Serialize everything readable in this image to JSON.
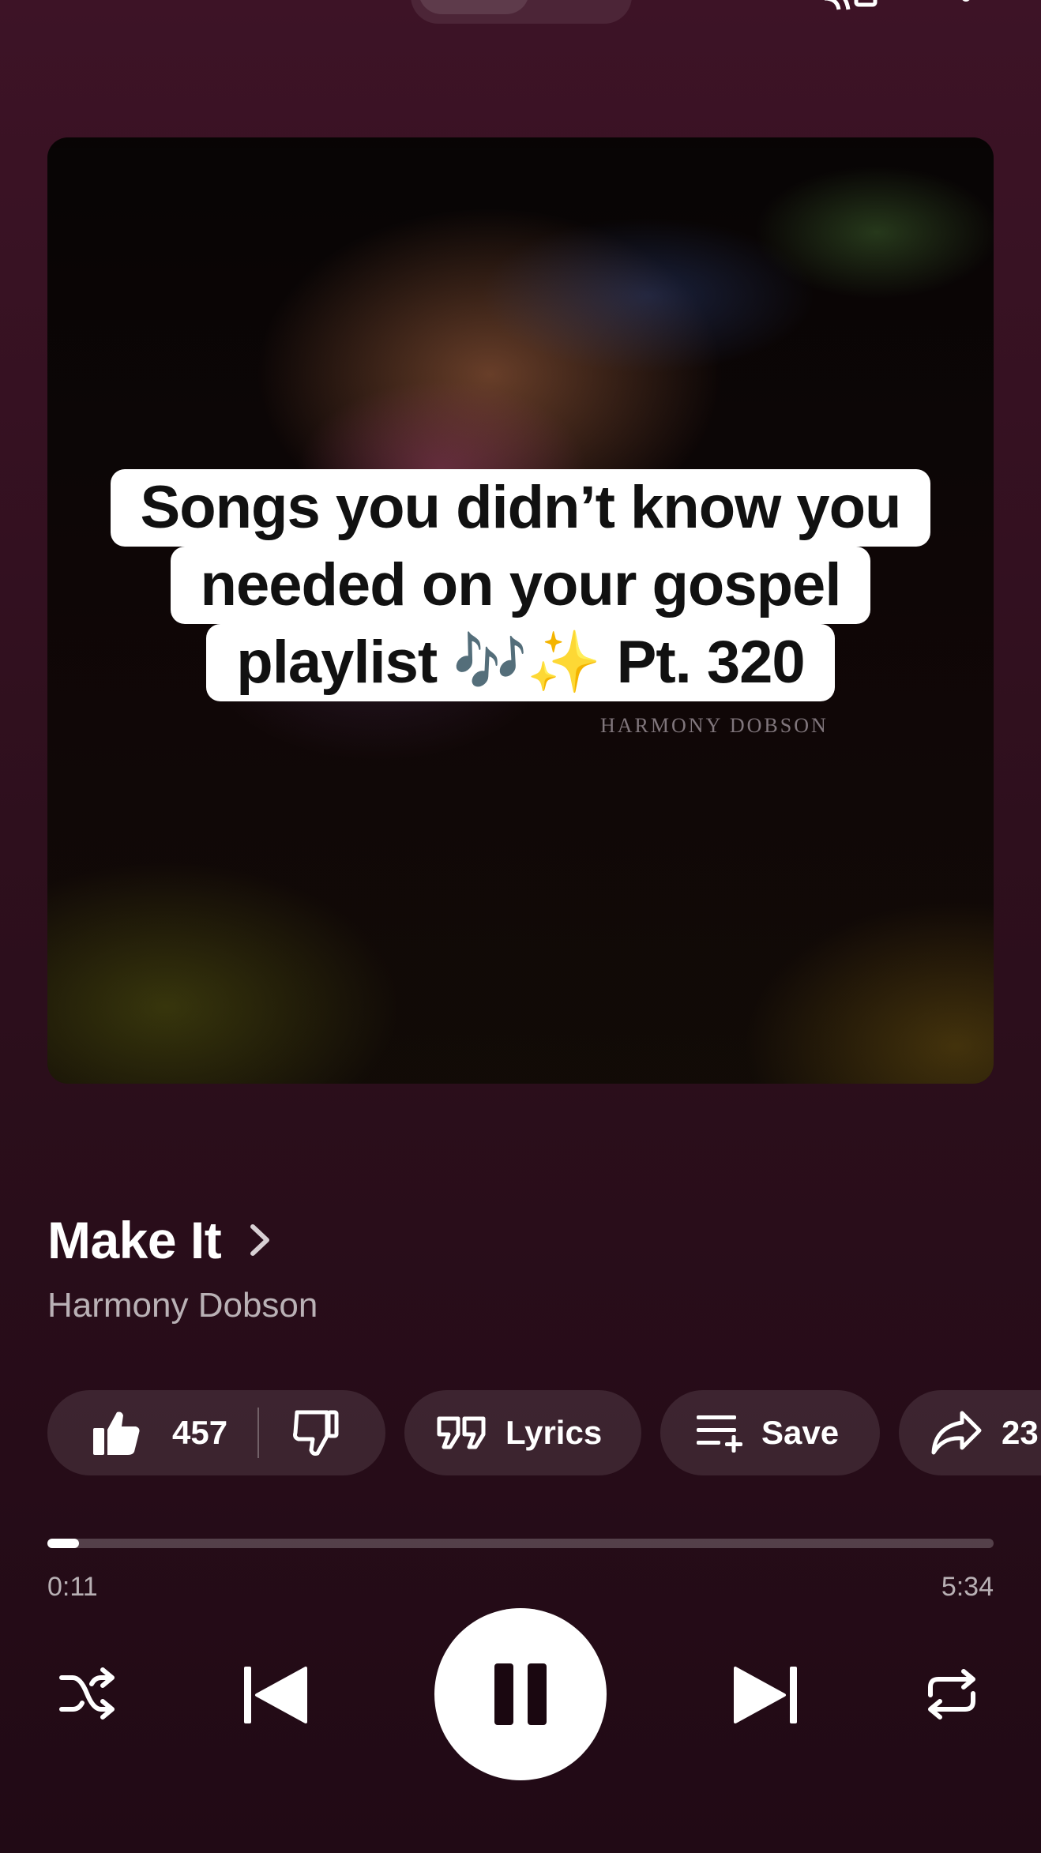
{
  "player": {
    "caption": {
      "line1": "Songs you didn’t know you",
      "line2": "needed on your gospel",
      "line3": "playlist 🎶✨ Pt. 320"
    },
    "art_watermark": "HARMONY DOBSON",
    "track": {
      "title": "Make It",
      "artist": "Harmony Dobson"
    },
    "actions": {
      "like_count": "457",
      "lyrics_label": "Lyrics",
      "save_label": "Save",
      "share_count": "23"
    },
    "progress": {
      "elapsed": "0:11",
      "total": "5:34",
      "fraction": 0.033
    }
  },
  "icons": {
    "top_bar": [
      "cast-icon",
      "more-vert-icon"
    ],
    "actions": [
      "thumbs-up-icon",
      "thumbs-down-icon",
      "quote-icon",
      "playlist-add-icon",
      "share-icon"
    ],
    "transport": [
      "shuffle-icon",
      "skip-previous-icon",
      "pause-icon",
      "skip-next-icon",
      "repeat-icon"
    ]
  },
  "colors": {
    "background_top": "#3d1326",
    "background_bottom": "#210a15",
    "accent": "#ffffff",
    "chip": "rgba(255,255,255,0.10)"
  }
}
